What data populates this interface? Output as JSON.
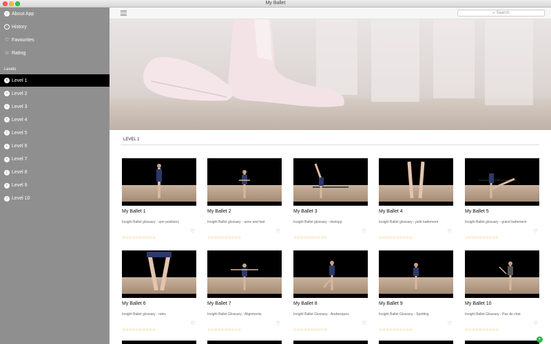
{
  "window": {
    "title": "My Ballet"
  },
  "sidebar": {
    "top_items": [
      {
        "label": "About App",
        "icon": "info-icon"
      },
      {
        "label": "History",
        "icon": "clock-icon"
      },
      {
        "label": "Favourites",
        "icon": "heart-icon"
      },
      {
        "label": "Rating",
        "icon": "star-icon"
      }
    ],
    "section_label": "Levels",
    "levels": [
      "Level 1",
      "Level 2",
      "Level 3",
      "Level 4",
      "Level 5",
      "Level 6",
      "Level 7",
      "Level 8",
      "Level 9",
      "Level 10"
    ],
    "active_level": 0
  },
  "toolbar": {
    "search_placeholder": "Search",
    "icon": "list-icon"
  },
  "content": {
    "level_title": "LEVEL 1",
    "rating_glyphs": "☆☆☆☆☆☆☆☆☆☆",
    "cards": [
      {
        "title": "My Ballet 1",
        "subtitle": "Insight Ballet glossary - arm positions"
      },
      {
        "title": "My Ballet 2",
        "subtitle": "Insight Ballet glossary - arms and feet"
      },
      {
        "title": "My Ballet 3",
        "subtitle": "Insight Ballet glossary - dvelopp"
      },
      {
        "title": "My Ballet 4",
        "subtitle": "Insight Ballet glossary - petit battement"
      },
      {
        "title": "My Ballet 5",
        "subtitle": "Insight Ballet glossary - grand battement"
      },
      {
        "title": "My Ballet 6",
        "subtitle": "Insight Ballet glossary - relev"
      },
      {
        "title": "My Ballet 7",
        "subtitle": "Insight Ballet Glossary - Alignments"
      },
      {
        "title": "My Ballet 8",
        "subtitle": "Insight Ballet Glossary - Arabesques"
      },
      {
        "title": "My Ballet 9",
        "subtitle": "Insight Ballet Glossary - Spotting"
      },
      {
        "title": "My Ballet 10",
        "subtitle": "Insight Ballet Glossary - Pas de chat"
      }
    ]
  },
  "colors": {
    "sidebar": "#8f8f8f",
    "active": "#000000",
    "stars": "#e8a93b",
    "heart": "#e85b74",
    "fab": "#2eb34a"
  }
}
